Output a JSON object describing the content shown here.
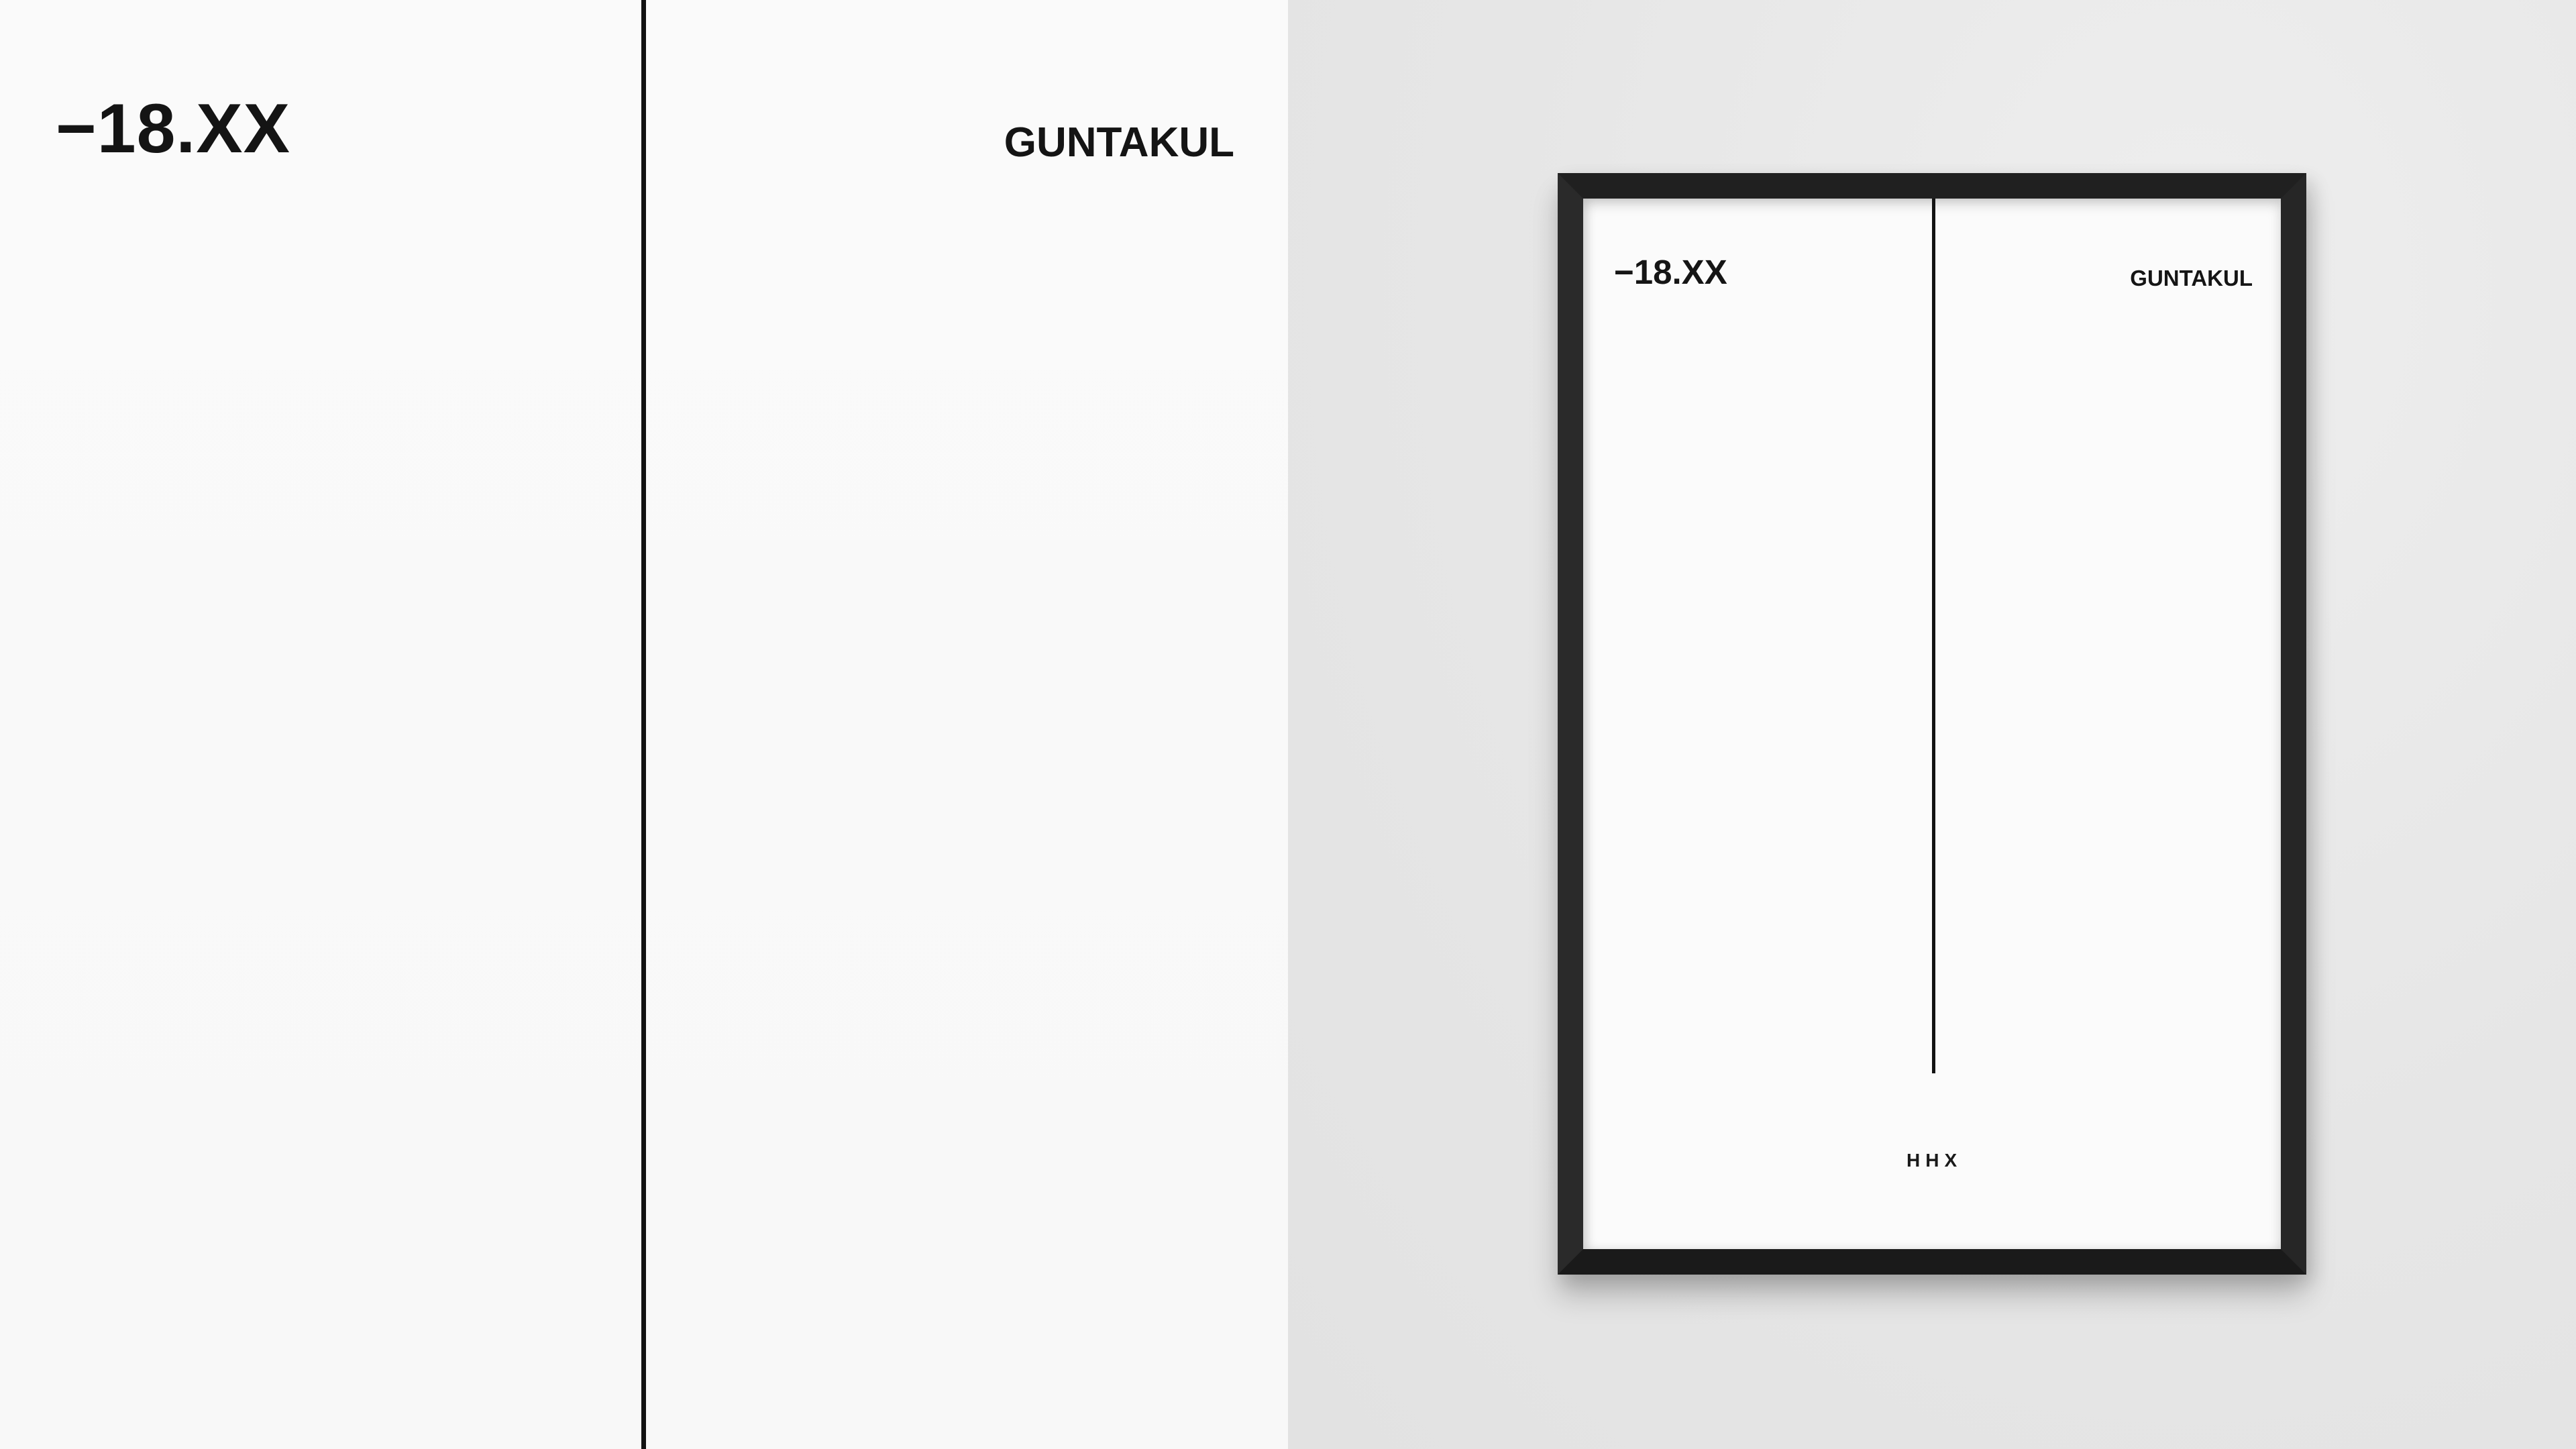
{
  "detail": {
    "temperature": "−18.XX",
    "city": "GUNTAKUL"
  },
  "poster": {
    "temperature": "−18.XX",
    "city": "GUNTAKUL",
    "code": "HHX"
  },
  "colors": {
    "ink": "#141414",
    "paper": "#f9f9f9",
    "wall": "#e6e6e6",
    "frame": "#1f1f1f"
  }
}
